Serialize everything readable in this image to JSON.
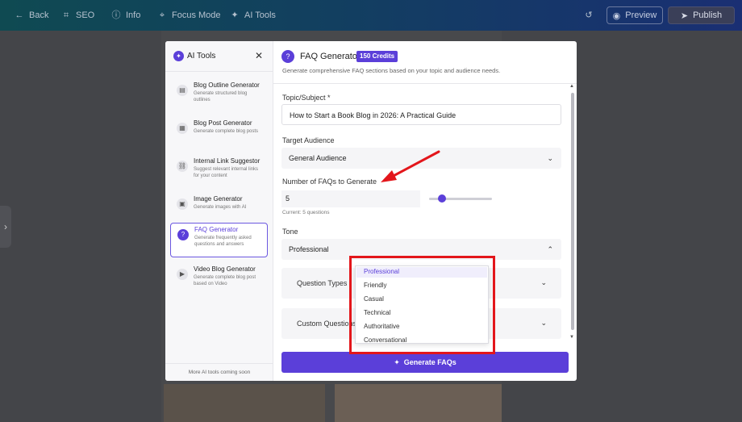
{
  "topbar": {
    "back": "Back",
    "seo": "SEO",
    "info": "Info",
    "focus_mode": "Focus Mode",
    "ai_tools": "AI Tools",
    "preview": "Preview",
    "publish": "Publish"
  },
  "left_panel": {
    "title": "AI Tools",
    "tools": [
      {
        "name": "Blog Outline Generator",
        "desc": "Generate structured blog outlines"
      },
      {
        "name": "Blog Post Generator",
        "desc": "Generate complete blog posts"
      },
      {
        "name": "Internal Link Suggestor",
        "desc": "Suggest relevant internal links for your content"
      },
      {
        "name": "Image Generator",
        "desc": "Generate images with AI"
      },
      {
        "name": "FAQ Generator",
        "desc": "Generate frequently asked questions and answers"
      },
      {
        "name": "Video Blog Generator",
        "desc": "Generate complete blog post based on Video"
      }
    ],
    "footer": "More AI tools coming soon"
  },
  "faq": {
    "title": "FAQ Generator",
    "credits": "150 Credits",
    "description": "Generate comprehensive FAQ sections based on your topic and audience needs.",
    "topic_label": "Topic/Subject *",
    "topic_value": "How to Start a Book Blog in 2026: A Practical Guide",
    "audience_label": "Target Audience",
    "audience_value": "General Audience",
    "count_label": "Number of FAQs to Generate",
    "count_value": "5",
    "count_hint": "Current: 5 questions",
    "count_slider_fraction": 0.2,
    "tone_label": "Tone",
    "tone_value": "Professional",
    "question_types_label": "Question Types",
    "custom_questions_label": "Custom Questions",
    "generate_label": "Generate FAQs",
    "tone_options": [
      "Professional",
      "Friendly",
      "Casual",
      "Technical",
      "Authoritative",
      "Conversational"
    ]
  },
  "colors": {
    "accent": "#5b3fd9",
    "annotation": "#e3161b"
  }
}
